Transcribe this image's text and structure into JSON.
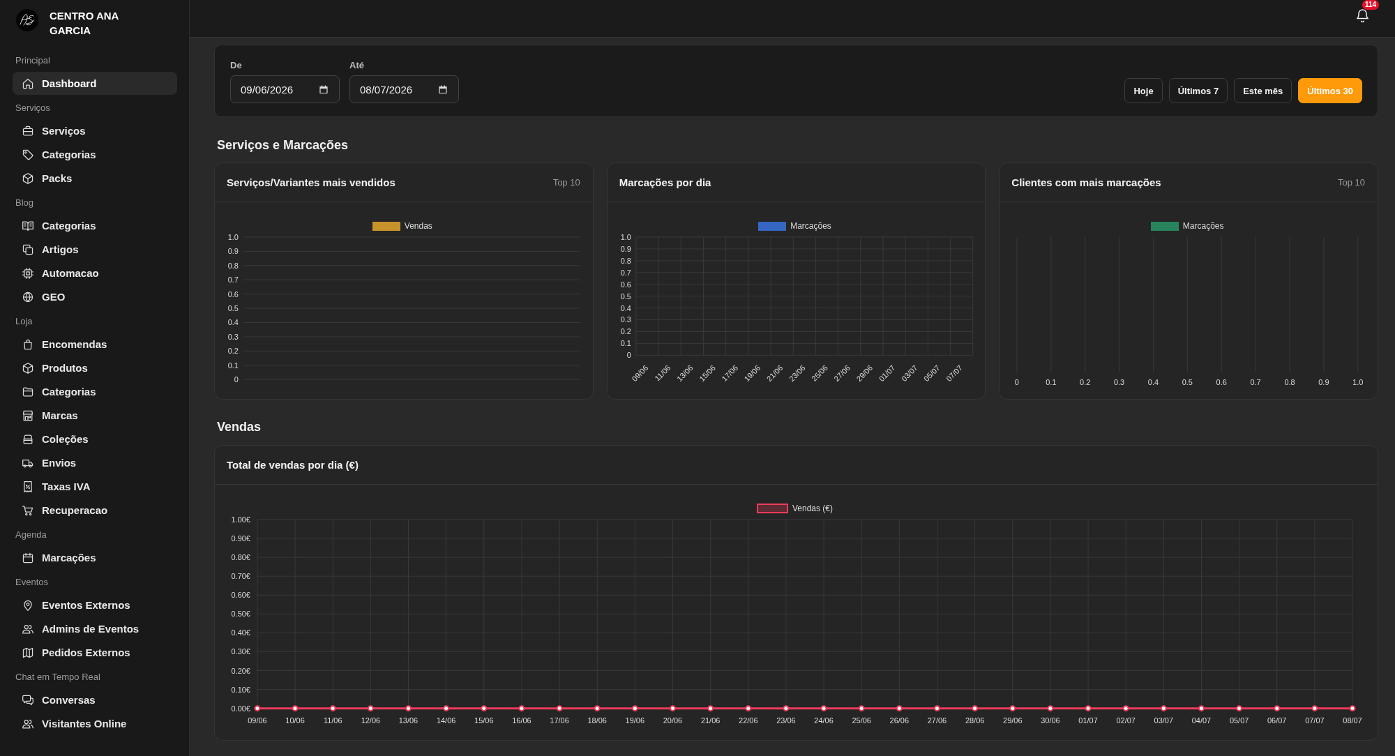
{
  "sidebar": {
    "brand": "CENTRO ANA GARCIA",
    "sections": [
      {
        "title": "Principal",
        "items": [
          {
            "label": "Dashboard",
            "selected": true
          }
        ]
      },
      {
        "title": "Serviços",
        "items": [
          {
            "label": "Serviços",
            "selected": false
          },
          {
            "label": "Categorias",
            "selected": false
          },
          {
            "label": "Packs",
            "selected": false
          }
        ]
      },
      {
        "title": "Blog",
        "items": [
          {
            "label": "Categorias",
            "selected": false
          },
          {
            "label": "Artigos",
            "selected": false
          },
          {
            "label": "Automacao",
            "selected": false
          },
          {
            "label": "GEO",
            "selected": false
          }
        ]
      },
      {
        "title": "Loja",
        "items": [
          {
            "label": "Encomendas",
            "selected": false
          },
          {
            "label": "Produtos",
            "selected": false
          },
          {
            "label": "Categorias",
            "selected": false
          },
          {
            "label": "Marcas",
            "selected": false
          },
          {
            "label": "Coleções",
            "selected": false
          },
          {
            "label": "Envios",
            "selected": false
          },
          {
            "label": "Taxas IVA",
            "selected": false
          },
          {
            "label": "Recuperacao",
            "selected": false
          }
        ]
      },
      {
        "title": "Agenda",
        "items": [
          {
            "label": "Marcações",
            "selected": false
          }
        ]
      },
      {
        "title": "Eventos",
        "items": [
          {
            "label": "Eventos Externos",
            "selected": false
          },
          {
            "label": "Admins de Eventos",
            "selected": false
          },
          {
            "label": "Pedidos Externos",
            "selected": false
          }
        ]
      },
      {
        "title": "Chat em Tempo Real",
        "items": [
          {
            "label": "Conversas",
            "selected": false
          },
          {
            "label": "Visitantes Online",
            "selected": false
          }
        ]
      }
    ]
  },
  "topbar": {
    "notification_count": "114"
  },
  "filters": {
    "from": {
      "label": "De",
      "value": "09/06/2026"
    },
    "to": {
      "label": "Até",
      "value": "08/07/2026"
    },
    "presets": [
      {
        "label": "Hoje",
        "selected": false
      },
      {
        "label": "Últimos 7",
        "selected": false
      },
      {
        "label": "Este mês",
        "selected": false
      },
      {
        "label": "Últimos 30",
        "selected": true
      }
    ]
  },
  "sections": [
    {
      "title": "Serviços e Marcações",
      "cards": [
        {
          "title": "Serviços/Variantes mais vendidos",
          "caption": "Top 10",
          "chart_data": {
            "type": "bar",
            "orientation": "vertical",
            "grid": true,
            "series": [
              {
                "name": "Vendas",
                "color": "#c8922a"
              }
            ],
            "ylim": [
              0,
              1
            ],
            "yticks": [
              0,
              0.1,
              0.2,
              0.3,
              0.4,
              0.5,
              0.6,
              0.7,
              0.8,
              0.9,
              {
                "value": 1,
                "label": "1.0"
              }
            ]
          }
        },
        {
          "title": "Marcações por dia",
          "chart_data": {
            "type": "bar",
            "orientation": "vertical",
            "grid": true,
            "categories": [
              "09/06",
              "11/06",
              "13/06",
              "15/06",
              "17/06",
              "19/06",
              "21/06",
              "23/06",
              "25/06",
              "27/06",
              "29/06",
              "01/07",
              "03/07",
              "05/07",
              "07/07"
            ],
            "series": [
              {
                "name": "Marcações",
                "color": "#3566c4",
                "values": [
                  0,
                  0,
                  0,
                  0,
                  0,
                  0,
                  0,
                  0,
                  0,
                  0,
                  0,
                  0,
                  0,
                  0,
                  0
                ]
              }
            ],
            "ylim": [
              0,
              1
            ],
            "yticks": [
              0,
              0.1,
              0.2,
              0.3,
              0.4,
              0.5,
              0.6,
              0.7,
              0.8,
              0.9,
              {
                "value": 1,
                "label": "1.0"
              }
            ]
          }
        },
        {
          "title": "Clientes com mais marcações",
          "caption": "Top 10",
          "chart_data": {
            "type": "bar",
            "orientation": "horizontal",
            "grid": true,
            "series": [
              {
                "name": "Marcações",
                "color": "#27845c"
              }
            ],
            "xlim": [
              0,
              1
            ],
            "xticks": [
              0,
              0.1,
              0.2,
              0.3,
              0.4,
              0.5,
              0.6,
              0.7,
              0.8,
              0.9,
              {
                "value": 1,
                "label": "1.0"
              }
            ]
          }
        }
      ]
    },
    {
      "title": "Vendas",
      "cards": [
        {
          "title": "Total de vendas por dia (€)",
          "chart_data": {
            "type": "line",
            "grid": true,
            "x": [
              "09/06",
              "10/06",
              "11/06",
              "12/06",
              "13/06",
              "14/06",
              "15/06",
              "16/06",
              "17/06",
              "18/06",
              "19/06",
              "20/06",
              "21/06",
              "22/06",
              "23/06",
              "24/06",
              "25/06",
              "26/06",
              "27/06",
              "28/06",
              "29/06",
              "30/06",
              "01/07",
              "02/07",
              "03/07",
              "04/07",
              "05/07",
              "06/07",
              "07/07",
              "08/07"
            ],
            "series": [
              {
                "name": "Vendas (€)",
                "color": "#ec3b5b",
                "marker": "circle",
                "values": [
                  0,
                  0,
                  0,
                  0,
                  0,
                  0,
                  0,
                  0,
                  0,
                  0,
                  0,
                  0,
                  0,
                  0,
                  0,
                  0,
                  0,
                  0,
                  0,
                  0,
                  0,
                  0,
                  0,
                  0,
                  0,
                  0,
                  0,
                  0,
                  0,
                  0
                ]
              }
            ],
            "ylim": [
              0,
              1
            ],
            "yticks": [
              {
                "value": 0,
                "label": "0.00€"
              },
              {
                "value": 0.1,
                "label": "0.10€"
              },
              {
                "value": 0.2,
                "label": "0.20€"
              },
              {
                "value": 0.3,
                "label": "0.30€"
              },
              {
                "value": 0.4,
                "label": "0.40€"
              },
              {
                "value": 0.5,
                "label": "0.50€"
              },
              {
                "value": 0.6,
                "label": "0.60€"
              },
              {
                "value": 0.7,
                "label": "0.70€"
              },
              {
                "value": 0.8,
                "label": "0.80€"
              },
              {
                "value": 0.9,
                "label": "0.90€"
              },
              {
                "value": 1,
                "label": "1.00€"
              }
            ]
          }
        }
      ]
    }
  ]
}
